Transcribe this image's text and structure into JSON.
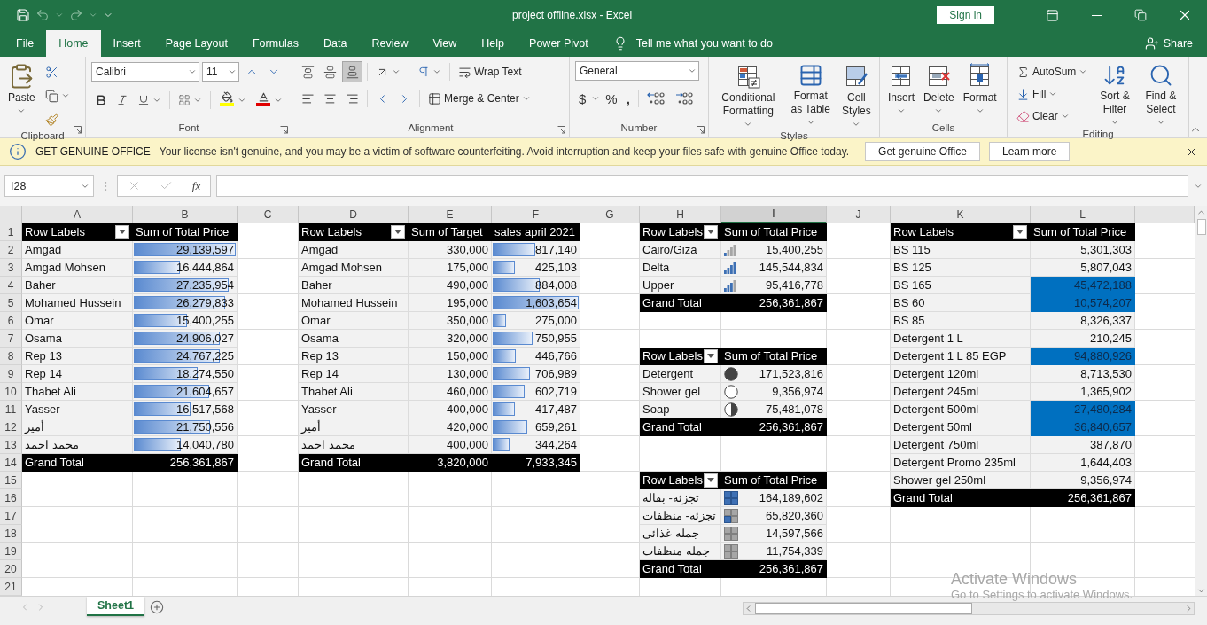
{
  "window": {
    "title": "project offline.xlsx - Excel",
    "sign_in": "Sign in"
  },
  "menu_tabs": [
    {
      "label": "File",
      "selected": false
    },
    {
      "label": "Home",
      "selected": true
    },
    {
      "label": "Insert",
      "selected": false
    },
    {
      "label": "Page Layout",
      "selected": false
    },
    {
      "label": "Formulas",
      "selected": false
    },
    {
      "label": "Data",
      "selected": false
    },
    {
      "label": "Review",
      "selected": false
    },
    {
      "label": "View",
      "selected": false
    },
    {
      "label": "Help",
      "selected": false
    },
    {
      "label": "Power Pivot",
      "selected": false
    }
  ],
  "tell_me": "Tell me what you want to do",
  "share": "Share",
  "ribbon": {
    "groups": [
      {
        "kind": "clipboard",
        "name": "Clipboard",
        "paste": "Paste"
      },
      {
        "kind": "font",
        "name": "Font",
        "font": "Calibri",
        "size": "11"
      },
      {
        "kind": "alignment",
        "name": "Alignment",
        "valign": [
          {
            "selected": false
          },
          {
            "selected": false
          },
          {
            "selected": true
          }
        ],
        "wrap": "Wrap Text",
        "merge": "Merge & Center"
      },
      {
        "kind": "number",
        "name": "Number",
        "format": "General",
        "currency": "$",
        "percent": "%",
        "comma": ","
      },
      {
        "kind": "styles",
        "name": "Styles",
        "buttons": [
          "Conditional Formatting",
          "Format as Table",
          "Cell Styles"
        ]
      },
      {
        "kind": "cells",
        "name": "Cells",
        "buttons": [
          "Insert",
          "Delete",
          "Format"
        ]
      },
      {
        "kind": "editing",
        "name": "Editing",
        "small": [
          "AutoSum",
          "Fill",
          "Clear"
        ],
        "big": [
          "Sort & Filter",
          "Find & Select"
        ]
      }
    ]
  },
  "message_bar": {
    "title": "GET GENUINE OFFICE",
    "text": "Your license isn't genuine, and you may be a victim of software counterfeiting. Avoid interruption and keep your files safe with genuine Office today.",
    "buttons": [
      "Get genuine Office",
      "Learn more"
    ]
  },
  "formula_bar": {
    "name_box": "I28",
    "fx": "fx"
  },
  "sheet": {
    "columns": [
      {
        "label": "A",
        "selected": false
      },
      {
        "label": "B",
        "selected": false
      },
      {
        "label": "C",
        "selected": false
      },
      {
        "label": "D",
        "selected": false
      },
      {
        "label": "E",
        "selected": false
      },
      {
        "label": "F",
        "selected": false
      },
      {
        "label": "G",
        "selected": false
      },
      {
        "label": "H",
        "selected": false
      },
      {
        "label": "I",
        "selected": true
      },
      {
        "label": "J",
        "selected": false
      },
      {
        "label": "K",
        "selected": false
      },
      {
        "label": "L",
        "selected": false
      }
    ],
    "rows": [
      "1",
      "2",
      "3",
      "4",
      "5",
      "6",
      "7",
      "8",
      "9",
      "10",
      "11",
      "12",
      "13",
      "14",
      "15",
      "16",
      "17",
      "18",
      "19",
      "20",
      "21"
    ],
    "pivots": [
      {
        "kind": "databar",
        "headers": [
          "Row Labels",
          "Sum of Total Price"
        ],
        "rows": [
          {
            "cells": [
              "Amgad",
              "29,139,597"
            ],
            "level": 1
          },
          {
            "cells": [
              "Amgad Mohsen",
              "16,444,864"
            ],
            "level": 0.46
          },
          {
            "cells": [
              "Baher",
              "27,235,954"
            ],
            "level": 0.93
          },
          {
            "cells": [
              "Mohamed Hussein",
              "26,279,833"
            ],
            "level": 0.9
          },
          {
            "cells": [
              "Omar",
              "15,400,255"
            ],
            "level": 0.53
          },
          {
            "cells": [
              "Osama",
              "24,906,027"
            ],
            "level": 0.85
          },
          {
            "cells": [
              "Rep 13",
              "24,767,225"
            ],
            "level": 0.85
          },
          {
            "cells": [
              "Rep 14",
              "18,274,550"
            ],
            "level": 0.63
          },
          {
            "cells": [
              "Thabet Ali",
              "21,604,657"
            ],
            "level": 0.74
          },
          {
            "cells": [
              "Yasser",
              "16,517,568"
            ],
            "level": 0.56
          },
          {
            "cells": [
              "أمير",
              "21,750,556"
            ],
            "level": 0.75
          },
          {
            "cells": [
              "محمد احمد",
              "14,040,780"
            ],
            "level": 0.47
          }
        ],
        "total": [
          "Grand Total",
          "256,361,867"
        ]
      },
      {
        "kind": "databar",
        "headers": [
          "Row Labels",
          "Sum of Target",
          "sales april 2021"
        ],
        "rows": [
          {
            "cells": [
              "Amgad",
              "330,000",
              "817,140"
            ],
            "level": 0.51
          },
          {
            "cells": [
              "Amgad Mohsen",
              "175,000",
              "425,103"
            ],
            "level": 0.27
          },
          {
            "cells": [
              "Baher",
              "490,000",
              "884,008"
            ],
            "level": 0.56
          },
          {
            "cells": [
              "Mohamed Hussein",
              "195,000",
              "1,603,654"
            ],
            "level": 1
          },
          {
            "cells": [
              "Omar",
              "350,000",
              "275,000"
            ],
            "level": 0.17
          },
          {
            "cells": [
              "Osama",
              "320,000",
              "750,955"
            ],
            "level": 0.47
          },
          {
            "cells": [
              "Rep 13",
              "150,000",
              "446,766"
            ],
            "level": 0.28
          },
          {
            "cells": [
              "Rep 14",
              "130,000",
              "706,989"
            ],
            "level": 0.44
          },
          {
            "cells": [
              "Thabet Ali",
              "460,000",
              "602,719"
            ],
            "level": 0.38
          },
          {
            "cells": [
              "Yasser",
              "400,000",
              "417,487"
            ],
            "level": 0.27
          },
          {
            "cells": [
              "أمير",
              "420,000",
              "659,261"
            ],
            "level": 0.41
          },
          {
            "cells": [
              "محمد احمد",
              "400,000",
              "344,264"
            ],
            "level": 0.21
          }
        ],
        "total": [
          "Grand Total",
          "3,820,000",
          "7,933,345"
        ]
      },
      {
        "kind": "signal",
        "headers": [
          "Row Labels",
          "Sum of Total Price"
        ],
        "rows": [
          {
            "cells": [
              "Cairo/Giza",
              "15,400,255"
            ],
            "kind": "quarter"
          },
          {
            "cells": [
              "Delta",
              "145,544,834"
            ],
            "kind": "full"
          },
          {
            "cells": [
              "Upper",
              "95,416,778"
            ],
            "kind": "most"
          }
        ],
        "total": [
          "Grand Total",
          "256,361,867"
        ]
      },
      {
        "kind": "harvey",
        "headers": [
          "Row Labels",
          "Sum of Total Price"
        ],
        "rows": [
          {
            "cells": [
              "Detergent",
              "171,523,816"
            ],
            "kind": "full"
          },
          {
            "cells": [
              "Shower gel",
              "9,356,974"
            ],
            "kind": "empty"
          },
          {
            "cells": [
              "Soap",
              "75,481,078"
            ],
            "kind": "half"
          }
        ],
        "total": [
          "Grand Total",
          "256,361,867"
        ]
      },
      {
        "kind": "quad",
        "headers": [
          "Row Labels",
          "Sum of Total Price"
        ],
        "rows": [
          {
            "cells": [
              "تجزئه- بقالة",
              "164,189,602"
            ],
            "kind": "full"
          },
          {
            "cells": [
              "تجزئه- منظفات",
              "65,820,360"
            ],
            "kind": "quarter"
          },
          {
            "cells": [
              "جمله غذائى",
              "14,597,566"
            ],
            "kind": "empty"
          },
          {
            "cells": [
              "جمله منظفات",
              "11,754,339"
            ],
            "kind": "empty"
          }
        ],
        "total": [
          "Grand Total",
          "256,361,867"
        ]
      },
      {
        "kind": "fill",
        "headers": [
          "Row Labels",
          "Sum of Total Price"
        ],
        "rows": [
          {
            "cells": [
              "BS 115",
              "5,301,303"
            ],
            "highlighted": false
          },
          {
            "cells": [
              "BS 125",
              "5,807,043"
            ],
            "highlighted": false
          },
          {
            "cells": [
              "BS 165",
              "45,472,188"
            ],
            "highlighted": true
          },
          {
            "cells": [
              "BS 60",
              "10,574,207"
            ],
            "highlighted": true
          },
          {
            "cells": [
              "BS 85",
              "8,326,337"
            ],
            "highlighted": false
          },
          {
            "cells": [
              "Detergent 1 L",
              "210,245"
            ],
            "highlighted": false
          },
          {
            "cells": [
              "Detergent 1 L 85 EGP",
              "94,880,926"
            ],
            "highlighted": true
          },
          {
            "cells": [
              "Detergent 120ml",
              "8,713,530"
            ],
            "highlighted": false
          },
          {
            "cells": [
              "Detergent 245ml",
              "1,365,902"
            ],
            "highlighted": false
          },
          {
            "cells": [
              "Detergent 500ml",
              "27,480,284"
            ],
            "highlighted": true
          },
          {
            "cells": [
              "Detergent 50ml",
              "36,840,657"
            ],
            "highlighted": true
          },
          {
            "cells": [
              "Detergent 750ml",
              "387,870"
            ],
            "highlighted": false
          },
          {
            "cells": [
              "Detergent Promo 235ml",
              "1,644,403"
            ],
            "highlighted": false
          },
          {
            "cells": [
              "Shower gel 250ml",
              "9,356,974"
            ],
            "highlighted": false
          }
        ],
        "total": [
          "Grand Total",
          "256,361,867"
        ]
      }
    ]
  },
  "sheet_tabs": [
    {
      "label": "Sheet1",
      "selected": true
    }
  ],
  "os_notice": {
    "title": "Activate Windows",
    "text": "Go to Settings to activate Windows."
  }
}
